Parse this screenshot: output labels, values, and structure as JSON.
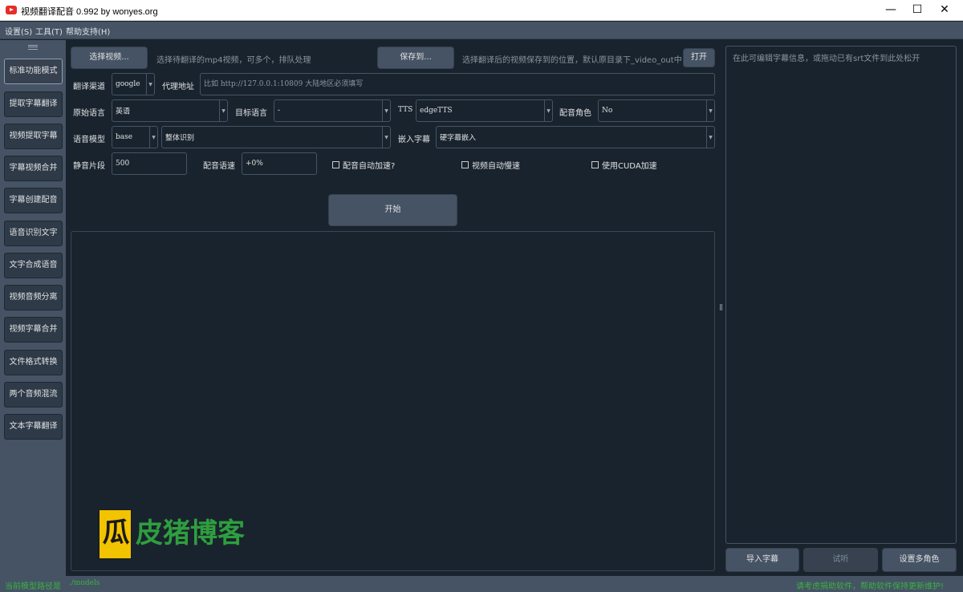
{
  "window": {
    "title": "视频翻译配音 0.992 by wonyes.org",
    "minimize": "—",
    "maximize": "☐",
    "close": "✕"
  },
  "menu": [
    "设置(S)",
    "工具(T)",
    "帮助支持(H)"
  ],
  "sidebar": {
    "items": [
      {
        "label": "标准功能模式",
        "active": true
      },
      {
        "label": "提取字幕翻译"
      },
      {
        "label": "视频提取字幕"
      },
      {
        "label": "字幕视频合并"
      },
      {
        "label": "字幕创建配音"
      },
      {
        "label": "语音识别文字"
      },
      {
        "label": "文字合成语音"
      },
      {
        "label": "视频音频分离"
      },
      {
        "label": "视频字幕合并"
      },
      {
        "label": "文件格式转换"
      },
      {
        "label": "两个音频混流"
      },
      {
        "label": "文本字幕翻译"
      }
    ]
  },
  "main": {
    "select_video_label": "选择视频...",
    "select_video_hint": "选择待翻译的mp4视频，可多个，排队处理",
    "save_to_label": "保存到...",
    "save_to_hint": "选择翻译后的视频保存到的位置，默认原目录下_video_out中",
    "open_label": "打开",
    "translate_channel_label": "翻译渠道",
    "translate_channel_value": "google",
    "proxy_label": "代理地址",
    "proxy_placeholder": "比如 http://127.0.0.1:10809 大陆地区必须填写",
    "source_lang_label": "原始语言",
    "source_lang_value": "英语",
    "target_lang_label": "目标语言",
    "target_lang_value": "-",
    "tts_label": "TTS",
    "tts_value": "edgeTTS",
    "voice_role_label": "配音角色",
    "voice_role_value": "No",
    "model_label": "语音模型",
    "model_value": "base",
    "recognition_value": "整体识别",
    "embed_subtitle_label": "嵌入字幕",
    "embed_subtitle_value": "硬字幕嵌入",
    "silence_label": "静音片段",
    "silence_value": "500",
    "voice_rate_label": "配音语速",
    "voice_rate_value": "+0%",
    "auto_speed_label": "配音自动加速?",
    "video_slow_label": "视频自动慢速",
    "cuda_label": "使用CUDA加速",
    "start_label": "开始"
  },
  "watermark": {
    "mark": "瓜",
    "text": "皮猪博客",
    "mark_color": "#f2c300",
    "text_color": "#2e9e3e"
  },
  "right_panel": {
    "placeholder": "在此可编辑字幕信息，或拖动已有srt文件到此处松开",
    "import_label": "导入字幕",
    "listen_label": "试听",
    "multi_role_label": "设置多角色"
  },
  "status": {
    "model_path_label": "当前模型路径是",
    "model_path_value": "./models",
    "right_message": "请考虑捐助软件，帮助软件保持更新维护!"
  },
  "colors": {
    "background": "#19232d",
    "panel": "#455364",
    "status_text": "#3bb143"
  }
}
